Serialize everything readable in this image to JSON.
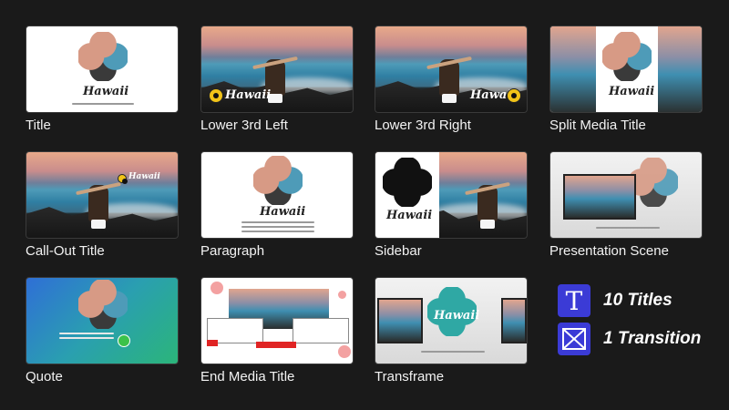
{
  "tiles": [
    {
      "label": "Title"
    },
    {
      "label": "Lower 3rd Left"
    },
    {
      "label": "Lower 3rd Right"
    },
    {
      "label": "Split Media Title"
    },
    {
      "label": "Call-Out Title"
    },
    {
      "label": "Paragraph"
    },
    {
      "label": "Sidebar"
    },
    {
      "label": "Presentation Scene"
    },
    {
      "label": "Quote"
    },
    {
      "label": "End Media Title"
    },
    {
      "label": "Transframe"
    }
  ],
  "thumb_text": {
    "script_word": "Hawaii",
    "callout_word": "Hawaii"
  },
  "summary": {
    "titles_icon_glyph": "T",
    "titles_label": "10 Titles",
    "transition_icon": "bowtie-transition-icon",
    "transition_label": "1 Transition"
  },
  "colors": {
    "background": "#1a1a1a",
    "icon_bg": "#3b3bd6",
    "badge": "#f1c318"
  }
}
